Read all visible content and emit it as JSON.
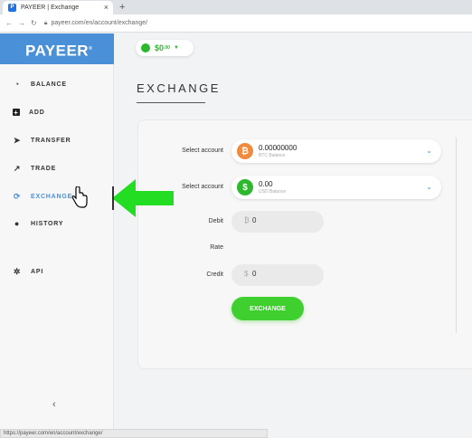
{
  "browser": {
    "tab_title": "PAYEER | Exchange",
    "tab_favicon": "P",
    "tab_close": "×",
    "new_tab": "+",
    "url": "payeer.com/en/account/exchange/",
    "status_url": "https://payeer.com/en/account/exchange/"
  },
  "sidebar": {
    "logo": "PAYEER",
    "logo_mark": "®",
    "items": [
      {
        "label": "BALANCE",
        "icon": "gauge-icon",
        "glyph": "◔"
      },
      {
        "label": "ADD",
        "icon": "plus-square-icon",
        "glyph": "+"
      },
      {
        "label": "TRANSFER",
        "icon": "paper-plane-icon",
        "glyph": "➤"
      },
      {
        "label": "TRADE",
        "icon": "chart-icon",
        "glyph": "↗"
      },
      {
        "label": "EXCHANGE",
        "icon": "exchange-icon",
        "glyph": "⟳"
      },
      {
        "label": "HISTORY",
        "icon": "clock-icon",
        "glyph": "●"
      },
      {
        "label": "API",
        "icon": "gears-icon",
        "glyph": "✲"
      }
    ],
    "collapse": "‹"
  },
  "header": {
    "balance": "$0",
    "balance_cents": ".00"
  },
  "page": {
    "title": "EXCHANGE"
  },
  "form": {
    "select_account_label": "Select account",
    "from_amount": "0.00000000",
    "from_sub": "BTC Balance",
    "to_amount": "0.00",
    "to_sub": "USD Balance",
    "debit_label": "Debit",
    "debit_currency": "₿",
    "debit_value": "0",
    "rate_label": "Rate",
    "credit_label": "Credit",
    "credit_currency": "$",
    "credit_value": "0",
    "button": "EXCHANGE"
  },
  "colors": {
    "brand": "#4a90d9",
    "green": "#3fcf2f",
    "btc": "#f08a3c"
  }
}
